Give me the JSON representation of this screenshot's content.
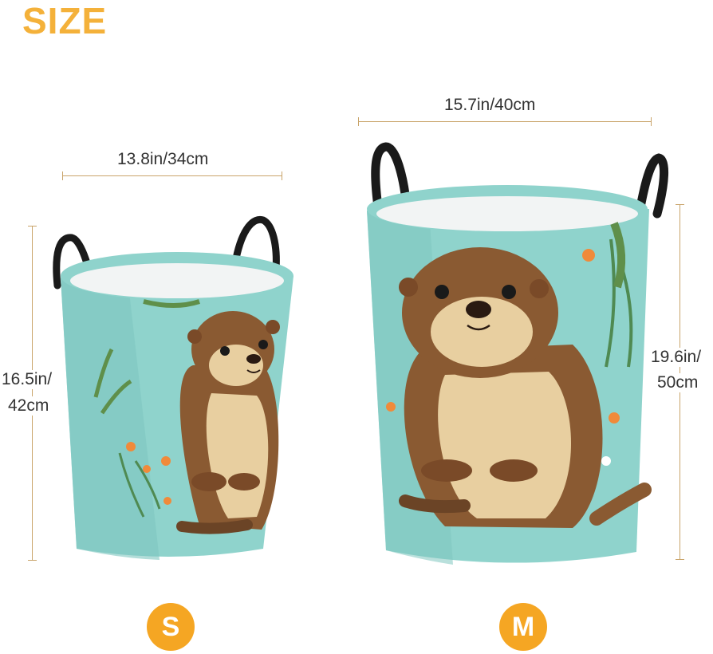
{
  "title": "SIZE",
  "sizes": {
    "small": {
      "badge": "S",
      "width_line1": "13.8in/34cm",
      "height_line1": "16.5in/",
      "height_line2": "42cm"
    },
    "medium": {
      "badge": "M",
      "width_line1": "15.7in/40cm",
      "height_line1": "19.6in/",
      "height_line2": "50cm"
    }
  },
  "colors": {
    "title": "#f4b13a",
    "badge": "#f5a623",
    "dimension_line": "#c9a46a",
    "basket_teal": "#8fd3cc",
    "otter_brown": "#8a5a32",
    "otter_cream": "#e8cfa0",
    "handle": "#1a1a1a"
  },
  "icons": [
    "otter-illustration",
    "laundry-basket"
  ]
}
